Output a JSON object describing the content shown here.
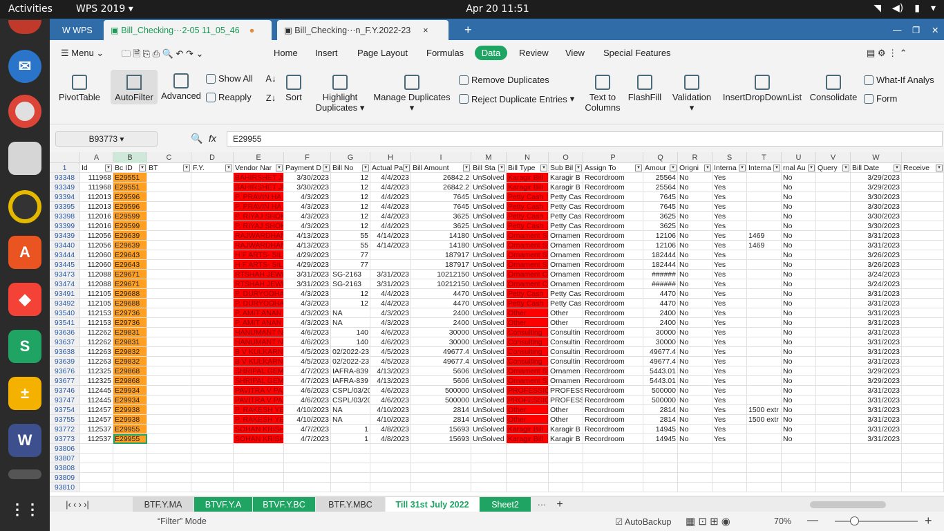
{
  "system": {
    "activities": "Activities",
    "app_menu": "WPS 2019",
    "datetime": "Apr 20  11:51"
  },
  "tabs": {
    "home": "WPS",
    "doc1": "Bill_Checking···2-05 11_05_46",
    "doc2": "Bill_Checking···n_F.Y.2022-23",
    "new": "+"
  },
  "menubar": {
    "menu": "Menu",
    "items": [
      "Home",
      "Insert",
      "Page Layout",
      "Formulas",
      "Data",
      "Review",
      "View",
      "Special Features"
    ]
  },
  "ribbon": {
    "pivot": "PivotTable",
    "autofilter": "AutoFilter",
    "advanced": "Advanced",
    "show_all": "Show All",
    "reapply": "Reapply",
    "sort": "Sort",
    "highlight1": "Highlight",
    "highlight2": "Duplicates",
    "manage": "Manage Duplicates",
    "remove_dup": "Remove Duplicates",
    "reject_dup": "Reject Duplicate Entries",
    "ttc1": "Text to",
    "ttc2": "Columns",
    "flashfill": "FlashFill",
    "validation": "Validation",
    "dropdown": "InsertDropDownList",
    "consolidate": "Consolidate",
    "whatif": "What-If Analys",
    "form": "Form"
  },
  "formula": {
    "namebox": "B93773",
    "fx": "fx",
    "value": "E29955"
  },
  "columns": [
    "A",
    "B",
    "C",
    "D",
    "E",
    "F",
    "G",
    "H",
    "I",
    "M",
    "N",
    "O",
    "P",
    "Q",
    "R",
    "S",
    "T",
    "U",
    "V",
    "W"
  ],
  "headers": [
    "Id",
    "Bc ID",
    "BT",
    "F.Y.",
    "Vendor Nar",
    "Payment D",
    "Bill No",
    "Actual Pa",
    "Bill Amount",
    "Bill Sta",
    "Bill Type",
    "Sub Bil",
    "Assign To",
    "Amour",
    "Origni",
    "Interna",
    "Interna",
    "rnal Au",
    "Query",
    "Bill Date",
    "Receive"
  ],
  "rows": [
    {
      "n": "93348",
      "id": "111968",
      "bc": "E29551",
      "v": "BAHIRSHET JE",
      "pd": "3/30/2023",
      "bn": "12",
      "ap": "4/4/2023",
      "amt": "26842.2",
      "st": "UnSolved",
      "bt": "Karagir Bill",
      "sb": "Karagir B",
      "as": "Recordroom",
      "am": "25564",
      "o": "No",
      "i1": "Yes",
      "i2": "",
      "ia": "No",
      "bd": "3/29/2023"
    },
    {
      "n": "93349",
      "id": "111968",
      "bc": "E29551",
      "v": "BAHIRSHET JE",
      "pd": "3/30/2023",
      "bn": "12",
      "ap": "4/4/2023",
      "amt": "26842.2",
      "st": "UnSolved",
      "bt": "Karagir Bill",
      "sb": "Karagir B",
      "as": "Recordroom",
      "am": "25564",
      "o": "No",
      "i1": "Yes",
      "i2": "",
      "ia": "No",
      "bd": "3/29/2023"
    },
    {
      "n": "93394",
      "id": "112013",
      "bc": "E29596",
      "v": "P. PRAVIN HA",
      "pd": "4/3/2023",
      "bn": "12",
      "ap": "4/4/2023",
      "amt": "7645",
      "st": "UnSolved",
      "bt": "Petty Cash",
      "sb": "Petty Cas",
      "as": "Recordroom",
      "am": "7645",
      "o": "No",
      "i1": "Yes",
      "i2": "",
      "ia": "No",
      "bd": "3/30/2023"
    },
    {
      "n": "93395",
      "id": "112013",
      "bc": "E29596",
      "v": "P. PRAVIN HA",
      "pd": "4/3/2023",
      "bn": "12",
      "ap": "4/4/2023",
      "amt": "7645",
      "st": "UnSolved",
      "bt": "Petty Cash",
      "sb": "Petty Cas",
      "as": "Recordroom",
      "am": "7645",
      "o": "No",
      "i1": "Yes",
      "i2": "",
      "ia": "No",
      "bd": "3/30/2023"
    },
    {
      "n": "93398",
      "id": "112016",
      "bc": "E29599",
      "v": "P. RIYAJ SHOK",
      "pd": "4/3/2023",
      "bn": "12",
      "ap": "4/4/2023",
      "amt": "3625",
      "st": "UnSolved",
      "bt": "Petty Cash",
      "sb": "Petty Cas",
      "as": "Recordroom",
      "am": "3625",
      "o": "No",
      "i1": "Yes",
      "i2": "",
      "ia": "No",
      "bd": "3/30/2023"
    },
    {
      "n": "93399",
      "id": "112016",
      "bc": "E29599",
      "v": "P. RIYAJ SHOK",
      "pd": "4/3/2023",
      "bn": "12",
      "ap": "4/4/2023",
      "amt": "3625",
      "st": "UnSolved",
      "bt": "Petty Cash",
      "sb": "Petty Cas",
      "as": "Recordroom",
      "am": "3625",
      "o": "No",
      "i1": "Yes",
      "i2": "",
      "ia": "No",
      "bd": "3/30/2023"
    },
    {
      "n": "93439",
      "id": "112056",
      "bc": "E29639",
      "v": "RAJWARDHAN",
      "pd": "4/13/2023",
      "bn": "55",
      "ap": "4/14/2023",
      "amt": "14180",
      "st": "UnSolved",
      "bt": "Ornament S",
      "sb": "Ornamen",
      "as": "Recordroom",
      "am": "12106",
      "o": "No",
      "i1": "Yes",
      "i2": "1469",
      "ia": "No",
      "bd": "3/31/2023"
    },
    {
      "n": "93440",
      "id": "112056",
      "bc": "E29639",
      "v": "RAJWARDHAN",
      "pd": "4/13/2023",
      "bn": "55",
      "ap": "4/14/2023",
      "amt": "14180",
      "st": "UnSolved",
      "bt": "Ornament S",
      "sb": "Ornamen",
      "as": "Recordroom",
      "am": "12106",
      "o": "No",
      "i1": "Yes",
      "i2": "1469",
      "ia": "No",
      "bd": "3/31/2023"
    },
    {
      "n": "93444",
      "id": "112060",
      "bc": "E29643",
      "v": "H F ARTS- SIL",
      "pd": "4/29/2023",
      "bn": "77",
      "ap": "",
      "amt": "187917",
      "st": "UnSolved",
      "bt": "Ornament S",
      "sb": "Ornamen",
      "as": "Recordroom",
      "am": "182444",
      "o": "No",
      "i1": "Yes",
      "i2": "",
      "ia": "No",
      "bd": "3/26/2023"
    },
    {
      "n": "93445",
      "id": "112060",
      "bc": "E29643",
      "v": "H F ARTS- SIL",
      "pd": "4/29/2023",
      "bn": "77",
      "ap": "",
      "amt": "187917",
      "st": "UnSolved",
      "bt": "Ornament S",
      "sb": "Ornamen",
      "as": "Recordroom",
      "am": "182444",
      "o": "No",
      "i1": "Yes",
      "i2": "",
      "ia": "No",
      "bd": "3/26/2023"
    },
    {
      "n": "93473",
      "id": "112088",
      "bc": "E29671",
      "v": "RTSHAH JEWE",
      "pd": "3/31/2023",
      "bn": "SG-2163",
      "ap": "3/31/2023",
      "amt": "10212150",
      "st": "UnSolved",
      "bt": "Ornament C",
      "sb": "Ornamen",
      "as": "Recordroom",
      "am": "######",
      "o": "No",
      "i1": "Yes",
      "i2": "",
      "ia": "No",
      "bd": "3/24/2023"
    },
    {
      "n": "93474",
      "id": "112088",
      "bc": "E29671",
      "v": "RTSHAH JEWE",
      "pd": "3/31/2023",
      "bn": "SG-2163",
      "ap": "3/31/2023",
      "amt": "10212150",
      "st": "UnSolved",
      "bt": "Ornament C",
      "sb": "Ornamen",
      "as": "Recordroom",
      "am": "######",
      "o": "No",
      "i1": "Yes",
      "i2": "",
      "ia": "No",
      "bd": "3/24/2023"
    },
    {
      "n": "93491",
      "id": "112105",
      "bc": "E29688",
      "v": "P. DURYODHA",
      "pd": "4/3/2023",
      "bn": "12",
      "ap": "4/4/2023",
      "amt": "4470",
      "st": "UnSolved",
      "bt": "Petty Cash",
      "sb": "Petty Cas",
      "as": "Recordroom",
      "am": "4470",
      "o": "No",
      "i1": "Yes",
      "i2": "",
      "ia": "No",
      "bd": "3/31/2023"
    },
    {
      "n": "93492",
      "id": "112105",
      "bc": "E29688",
      "v": "P. DURYODHA",
      "pd": "4/3/2023",
      "bn": "12",
      "ap": "4/4/2023",
      "amt": "4470",
      "st": "UnSolved",
      "bt": "Petty Cash",
      "sb": "Petty Cas",
      "as": "Recordroom",
      "am": "4470",
      "o": "No",
      "i1": "Yes",
      "i2": "",
      "ia": "No",
      "bd": "3/31/2023"
    },
    {
      "n": "93540",
      "id": "112153",
      "bc": "E29736",
      "v": "P. AMIT ANAN",
      "pd": "4/3/2023",
      "bn": "NA",
      "ap": "4/3/2023",
      "amt": "2400",
      "st": "UnSolved",
      "bt": "Other",
      "sb": "Other",
      "as": "Recordroom",
      "am": "2400",
      "o": "No",
      "i1": "Yes",
      "i2": "",
      "ia": "No",
      "bd": "3/31/2023"
    },
    {
      "n": "93541",
      "id": "112153",
      "bc": "E29736",
      "v": "P. AMIT ANAN",
      "pd": "4/3/2023",
      "bn": "NA",
      "ap": "4/3/2023",
      "amt": "2400",
      "st": "UnSolved",
      "bt": "Other",
      "sb": "Other",
      "as": "Recordroom",
      "am": "2400",
      "o": "No",
      "i1": "Yes",
      "i2": "",
      "ia": "No",
      "bd": "3/31/2023"
    },
    {
      "n": "93636",
      "id": "112262",
      "bc": "E29831",
      "v": "HANUMANT N",
      "pd": "4/6/2023",
      "bn": "140",
      "ap": "4/6/2023",
      "amt": "30000",
      "st": "UnSolved",
      "bt": "Consulting",
      "sb": "Consultin",
      "as": "Recordroom",
      "am": "30000",
      "o": "No",
      "i1": "Yes",
      "i2": "",
      "ia": "No",
      "bd": "3/31/2023"
    },
    {
      "n": "93637",
      "id": "112262",
      "bc": "E29831",
      "v": "HANUMANT N",
      "pd": "4/6/2023",
      "bn": "140",
      "ap": "4/6/2023",
      "amt": "30000",
      "st": "UnSolved",
      "bt": "Consulting",
      "sb": "Consultin",
      "as": "Recordroom",
      "am": "30000",
      "o": "No",
      "i1": "Yes",
      "i2": "",
      "ia": "No",
      "bd": "3/31/2023"
    },
    {
      "n": "93638",
      "id": "112263",
      "bc": "E29832",
      "v": "B V KULKARN",
      "pd": "4/5/2023",
      "bn": "02/2022-23",
      "ap": "4/5/2023",
      "amt": "49677.4",
      "st": "UnSolved",
      "bt": "Consulting",
      "sb": "Consultin",
      "as": "Recordroom",
      "am": "49677.4",
      "o": "No",
      "i1": "Yes",
      "i2": "",
      "ia": "No",
      "bd": "3/31/2023"
    },
    {
      "n": "93639",
      "id": "112263",
      "bc": "E29832",
      "v": "B V KULKARN",
      "pd": "4/5/2023",
      "bn": "02/2022-23",
      "ap": "4/5/2023",
      "amt": "49677.4",
      "st": "UnSolved",
      "bt": "Consulting",
      "sb": "Consultin",
      "as": "Recordroom",
      "am": "49677.4",
      "o": "No",
      "i1": "Yes",
      "i2": "",
      "ia": "No",
      "bd": "3/31/2023"
    },
    {
      "n": "93676",
      "id": "112325",
      "bc": "E29868",
      "v": "SHRIPAL GEM",
      "pd": "4/7/2023",
      "bn": "IAFRA-839",
      "ap": "4/13/2023",
      "amt": "5606",
      "st": "UnSolved",
      "bt": "Ornament S",
      "sb": "Ornamen",
      "as": "Recordroom",
      "am": "5443.01",
      "o": "No",
      "i1": "Yes",
      "i2": "",
      "ia": "No",
      "bd": "3/29/2023"
    },
    {
      "n": "93677",
      "id": "112325",
      "bc": "E29868",
      "v": "SHRIPAL GEM",
      "pd": "4/7/2023",
      "bn": "IAFRA-839",
      "ap": "4/13/2023",
      "amt": "5606",
      "st": "UnSolved",
      "bt": "Ornament S",
      "sb": "Ornamen",
      "as": "Recordroom",
      "am": "5443.01",
      "o": "No",
      "i1": "Yes",
      "i2": "",
      "ia": "No",
      "bd": "3/29/2023"
    },
    {
      "n": "93746",
      "id": "112445",
      "bc": "E29934",
      "v": "PAVITRA V PA",
      "pd": "4/6/2023",
      "bn": "CSPL/03/20",
      "ap": "4/6/2023",
      "amt": "500000",
      "st": "UnSolved",
      "bt": "PROFESSION",
      "sb": "PROFESSI",
      "as": "Recordroom",
      "am": "500000",
      "o": "No",
      "i1": "Yes",
      "i2": "",
      "ia": "No",
      "bd": "3/31/2023"
    },
    {
      "n": "93747",
      "id": "112445",
      "bc": "E29934",
      "v": "PAVITRA V PA",
      "pd": "4/6/2023",
      "bn": "CSPL/03/20",
      "ap": "4/6/2023",
      "amt": "500000",
      "st": "UnSolved",
      "bt": "PROFESSION",
      "sb": "PROFESSI",
      "as": "Recordroom",
      "am": "500000",
      "o": "No",
      "i1": "Yes",
      "i2": "",
      "ia": "No",
      "bd": "3/31/2023"
    },
    {
      "n": "93754",
      "id": "112457",
      "bc": "E29938",
      "v": "P. RAKESH YE",
      "pd": "4/10/2023",
      "bn": "NA",
      "ap": "4/10/2023",
      "amt": "2814",
      "st": "UnSolved",
      "bt": "Other",
      "sb": "Other",
      "as": "Recordroom",
      "am": "2814",
      "o": "No",
      "i1": "Yes",
      "i2": "1500 extr",
      "ia": "No",
      "bd": "3/31/2023"
    },
    {
      "n": "93755",
      "id": "112457",
      "bc": "E29938",
      "v": "P. RAKESH YE",
      "pd": "4/10/2023",
      "bn": "NA",
      "ap": "4/10/2023",
      "amt": "2814",
      "st": "UnSolved",
      "bt": "Other",
      "sb": "Other",
      "as": "Recordroom",
      "am": "2814",
      "o": "No",
      "i1": "Yes",
      "i2": "1500 extr",
      "ia": "No",
      "bd": "3/31/2023"
    },
    {
      "n": "93772",
      "id": "112537",
      "bc": "E29955",
      "v": "SOHAN KRISH",
      "pd": "4/7/2023",
      "bn": "1",
      "ap": "4/8/2023",
      "amt": "15693",
      "st": "UnSolved",
      "bt": "Karagir Bill",
      "sb": "Karagir B",
      "as": "Recordroom",
      "am": "14945",
      "o": "No",
      "i1": "Yes",
      "i2": "",
      "ia": "No",
      "bd": "3/31/2023"
    },
    {
      "n": "93773",
      "id": "112537",
      "bc": "E29955",
      "v": "SOHAN KRISH",
      "pd": "4/7/2023",
      "bn": "1",
      "ap": "4/8/2023",
      "amt": "15693",
      "st": "UnSolved",
      "bt": "Karagir Bill",
      "sb": "Karagir B",
      "as": "Recordroom",
      "am": "14945",
      "o": "No",
      "i1": "Yes",
      "i2": "",
      "ia": "No",
      "bd": "3/31/2023"
    }
  ],
  "empty_rows": [
    "93806",
    "93807",
    "93808",
    "93809",
    "93810"
  ],
  "header_row_num": "1",
  "sheets": [
    "BTF.Y.MA",
    "BTVF.Y.A",
    "BTVF.Y.BC",
    "BTF.Y.MBC",
    "Till 31st July 2022",
    "Sheet2"
  ],
  "status": {
    "mode": "“Filter”  Mode",
    "autobackup": "AutoBackup",
    "zoom": "70%"
  },
  "colors": {
    "red": "#ff0000",
    "orange": "#ffa023",
    "accent": "#1fa463"
  }
}
